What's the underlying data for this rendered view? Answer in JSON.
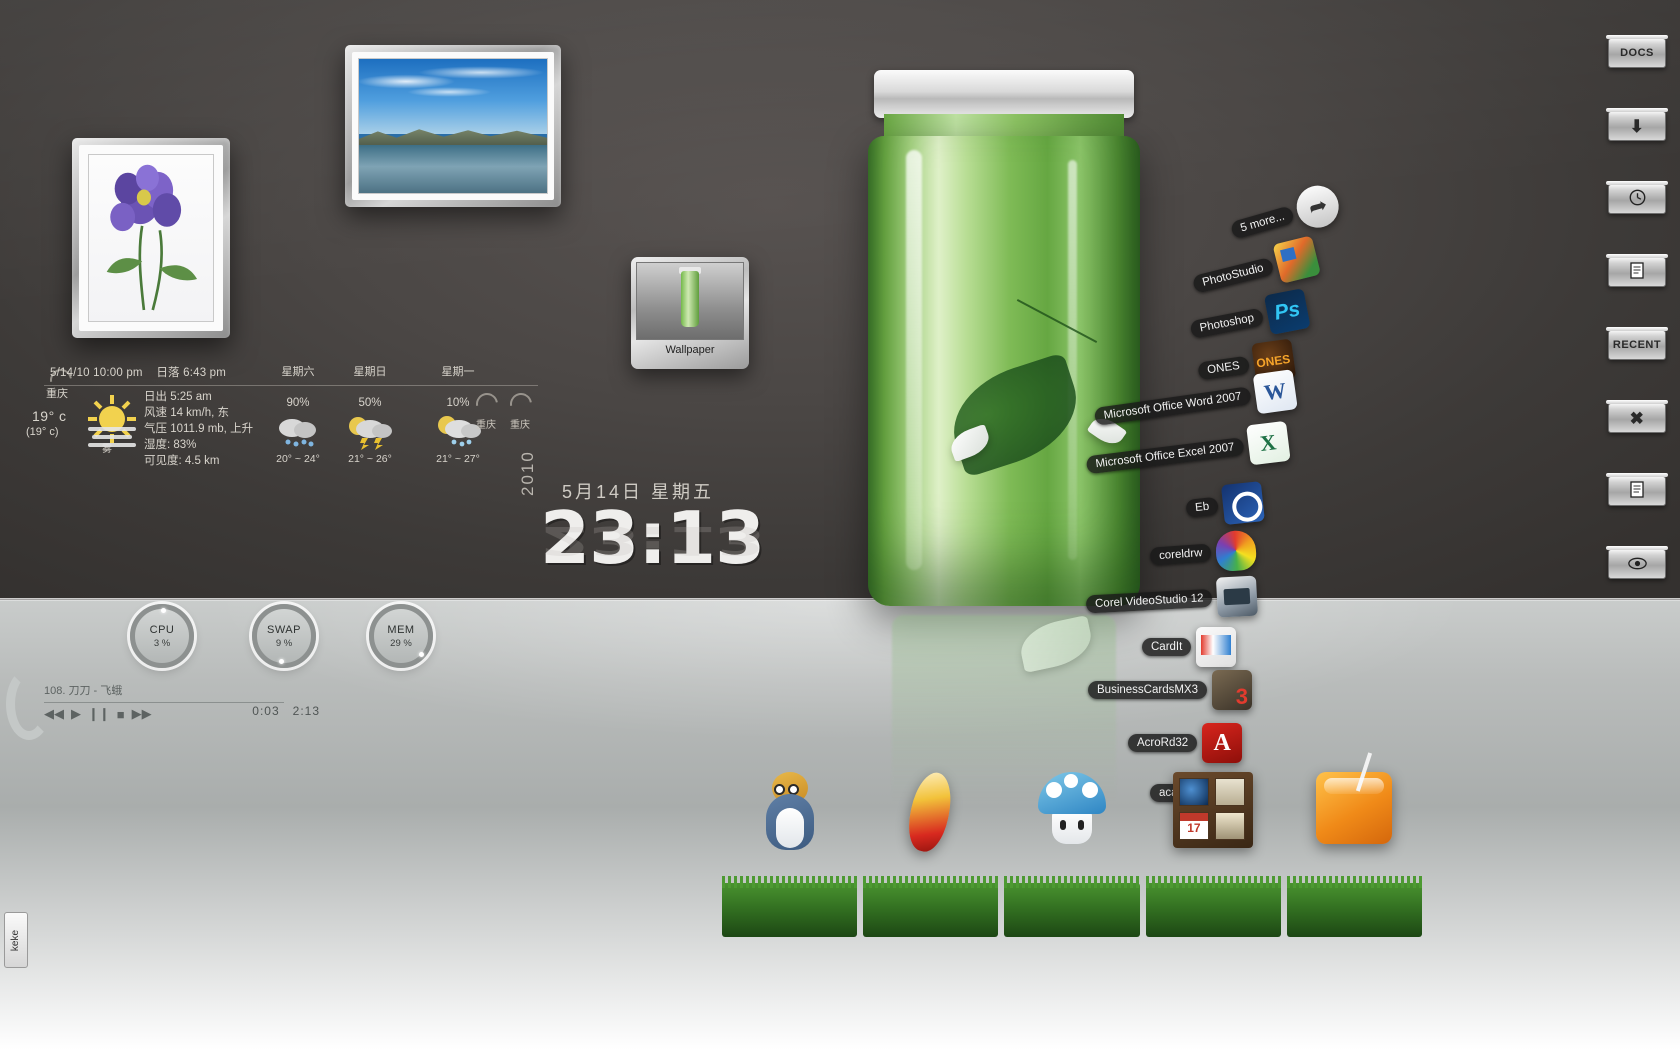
{
  "desktop": {
    "wallpaper_icon": {
      "label": "Wallpaper",
      "icon": "jar-thumbnail-icon"
    },
    "pictures": [
      {
        "name": "flowers-photo-frame",
        "subject": "purple iris flowers"
      },
      {
        "name": "lake-photo-frame",
        "subject": "mountain lake landscape"
      }
    ]
  },
  "weather": {
    "timestamp": "5/14/10 10:00 pm",
    "sunset_label": "日落 6:43 pm",
    "sunrise_label": "日出 5:25 am",
    "city": "重庆",
    "temp": "19° c",
    "feels_like": "(19° c)",
    "condition": "雾",
    "condition_icon": "sun-haze-icon",
    "details": [
      "风速 14 km/h, 东",
      "气压 1011.9 mb, 上升",
      "湿度: 83%",
      "可见度: 4.5 km"
    ],
    "forecast": [
      {
        "dow": "星期六",
        "pct": "90%",
        "range": "20° ~ 24°",
        "icon": "rain-icon"
      },
      {
        "dow": "星期日",
        "pct": "50%",
        "range": "21° ~ 26°",
        "icon": "thunderstorm-icon"
      },
      {
        "dow": "星期一",
        "pct": "10%",
        "range": "21° ~ 27°",
        "icon": "sun-storm-icon"
      }
    ],
    "mini_cities": [
      "重庆",
      "重庆"
    ]
  },
  "clock": {
    "date": "5月14日 星期五",
    "year": "2010",
    "time": "23:13"
  },
  "dock": {
    "items": [
      {
        "label": "5 more...",
        "icon": "arrow-forward-icon",
        "icon_class": "ic-arrow"
      },
      {
        "label": "PhotoStudio",
        "icon": "photostudio-icon",
        "icon_class": "ic-photostudio"
      },
      {
        "label": "Photoshop",
        "icon": "photoshop-icon",
        "icon_class": "ic-ps",
        "glyph": "Ps"
      },
      {
        "label": "ONES",
        "icon": "ones-icon",
        "icon_class": "ic-ones",
        "glyph": "ONES"
      },
      {
        "label": "Microsoft Office Word 2007",
        "icon": "word-icon",
        "icon_class": "ic-word",
        "glyph": "W"
      },
      {
        "label": "Microsoft Office Excel 2007",
        "icon": "excel-icon",
        "icon_class": "ic-excel",
        "glyph": "X"
      },
      {
        "label": "Eb",
        "icon": "eb-icon",
        "icon_class": "ic-eb"
      },
      {
        "label": "coreldrw",
        "icon": "coreldraw-balloon-icon",
        "icon_class": "ic-corel"
      },
      {
        "label": "Corel VideoStudio 12",
        "icon": "videostudio-camera-icon",
        "icon_class": "ic-video"
      },
      {
        "label": "CardIt",
        "icon": "cardit-icon",
        "icon_class": "ic-cardit"
      },
      {
        "label": "BusinessCardsMX3",
        "icon": "businesscardsmx-icon",
        "icon_class": "ic-bcmx"
      },
      {
        "label": "AcroRd32",
        "icon": "acrobat-reader-icon",
        "icon_class": "ic-acro",
        "glyph": "A"
      },
      {
        "label": "acad",
        "icon": "autocad-icon",
        "icon_class": "ic-acad"
      }
    ]
  },
  "sidebar": {
    "buttons": [
      {
        "label": "DOCS",
        "icon": "docs-label-icon",
        "type": "text"
      },
      {
        "label": "",
        "icon": "download-arrow-icon",
        "type": "icon",
        "glyph": "⬇"
      },
      {
        "label": "",
        "icon": "clock-icon",
        "type": "icon",
        "glyph": "🕐"
      },
      {
        "label": "",
        "icon": "document-icon",
        "type": "icon",
        "glyph": "🗎"
      },
      {
        "label": "RECENT",
        "icon": "recent-label-icon",
        "type": "text"
      },
      {
        "label": "",
        "icon": "close-x-icon",
        "type": "icon",
        "glyph": "✖"
      },
      {
        "label": "",
        "icon": "document-copy-icon",
        "type": "icon",
        "glyph": "🗎"
      },
      {
        "label": "",
        "icon": "eye-view-icon",
        "type": "icon",
        "glyph": "◉"
      }
    ]
  },
  "monitors": [
    {
      "name": "CPU",
      "value": "3 %"
    },
    {
      "name": "SWAP",
      "value": "9 %"
    },
    {
      "name": "MEM",
      "value": "29 %"
    }
  ],
  "player": {
    "track": "108. 刀刀 - 飞蛾",
    "elapsed": "0:03",
    "duration": "2:13",
    "controls": [
      {
        "name": "previous-button",
        "glyph": "◀◀"
      },
      {
        "name": "play-button",
        "glyph": "▶"
      },
      {
        "name": "pause-button",
        "glyph": "❙❙"
      },
      {
        "name": "stop-button",
        "glyph": "■"
      },
      {
        "name": "next-button",
        "glyph": "▶▶"
      }
    ]
  },
  "grass_dock": [
    {
      "name": "penguin-icon"
    },
    {
      "name": "surfboard-icon"
    },
    {
      "name": "mushroom-icon"
    },
    {
      "name": "shelf-calendar-icon"
    },
    {
      "name": "orange-cube-icon"
    }
  ],
  "taskbar": {
    "keke_label": "keke"
  },
  "colors": {
    "accent_green": "#7fbb56",
    "wall": "#4b4745",
    "floor": "#b9bcbb"
  }
}
